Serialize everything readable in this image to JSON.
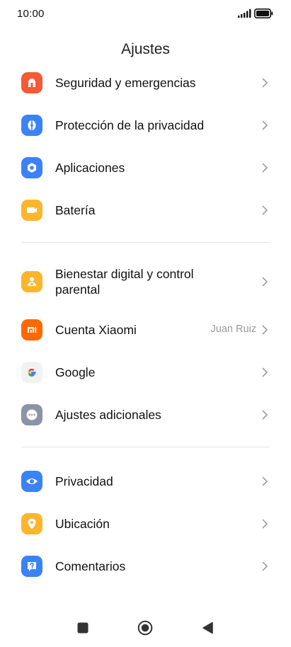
{
  "status_bar": {
    "time": "10:00",
    "signal_icon": "signal-icon",
    "battery_icon": "battery-icon"
  },
  "header": {
    "title": "Ajustes"
  },
  "sections": [
    {
      "items": [
        {
          "label": "Seguridad y emergencias",
          "icon": "sos-icon",
          "color": "#F35A35"
        },
        {
          "label": "Protección de la privacidad",
          "icon": "privacy-shield-icon",
          "color": "#3B82F6"
        },
        {
          "label": "Aplicaciones",
          "icon": "apps-hexagon-icon",
          "color": "#3B82F6"
        },
        {
          "label": "Batería",
          "icon": "battery-icon",
          "color": "#FDB52B"
        }
      ]
    },
    {
      "items": [
        {
          "label": "Bienestar digital y control parental",
          "icon": "wellbeing-icon",
          "color": "#FDB52B"
        },
        {
          "label": "Cuenta Xiaomi",
          "value": "Juan Ruiz",
          "icon": "mi-logo-icon",
          "color": "#FF6900"
        },
        {
          "label": "Google",
          "icon": "google-icon",
          "color": "#F2F2F2"
        },
        {
          "label": "Ajustes adicionales",
          "icon": "more-dots-icon",
          "color": "#8C93A8"
        }
      ]
    },
    {
      "items": [
        {
          "label": "Privacidad",
          "icon": "eye-icon",
          "color": "#3B82F6"
        },
        {
          "label": "Ubicación",
          "icon": "location-pin-icon",
          "color": "#FDB52B"
        },
        {
          "label": "Comentarios",
          "icon": "feedback-question-icon",
          "color": "#3B82F6"
        }
      ]
    }
  ],
  "nav_bar": {
    "recents_icon": "recents-square-icon",
    "home_icon": "home-circle-icon",
    "back_icon": "back-triangle-icon"
  }
}
